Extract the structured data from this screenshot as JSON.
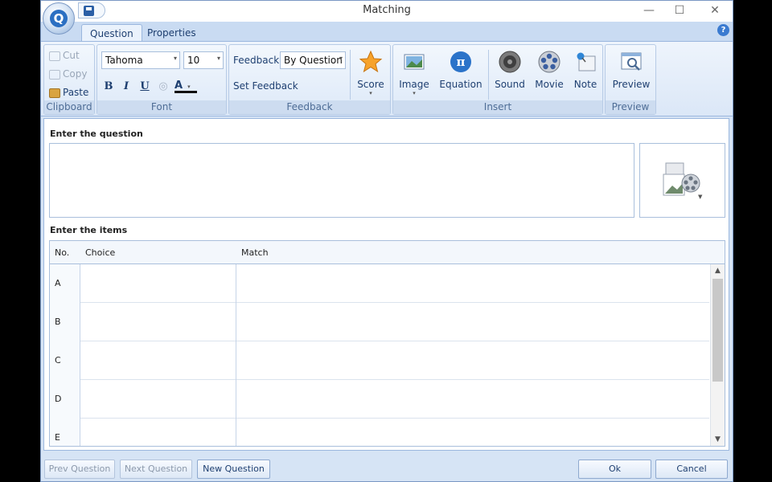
{
  "window": {
    "title": "Matching",
    "minimize": "—",
    "maximize": "☐",
    "close": "✕"
  },
  "tabs": [
    {
      "label": "Question"
    },
    {
      "label": "Properties"
    }
  ],
  "clipboard": {
    "cut": "Cut",
    "copy": "Copy",
    "paste": "Paste",
    "label": "Clipboard"
  },
  "font": {
    "name": "Tahoma",
    "size": "10",
    "bold": "B",
    "italic": "I",
    "underline": "U",
    "color_letter": "A",
    "label": "Font"
  },
  "feedback": {
    "feedback_label": "Feedback:",
    "feedback_value": "By Question",
    "set_feedback": "Set Feedback",
    "score": "Score",
    "label": "Feedback"
  },
  "insert": {
    "image": "Image",
    "equation": "Equation",
    "equation_symbol": "π",
    "sound": "Sound",
    "movie": "Movie",
    "note": "Note",
    "label": "Insert"
  },
  "preview": {
    "preview": "Preview",
    "label": "Preview"
  },
  "question": {
    "section_label": "Enter the question",
    "text": ""
  },
  "items": {
    "section_label": "Enter the items",
    "headers": {
      "no": "No.",
      "choice": "Choice",
      "match": "Match"
    },
    "rows": [
      {
        "no": "A",
        "choice": "",
        "match": ""
      },
      {
        "no": "B",
        "choice": "",
        "match": ""
      },
      {
        "no": "C",
        "choice": "",
        "match": ""
      },
      {
        "no": "D",
        "choice": "",
        "match": ""
      },
      {
        "no": "E",
        "choice": "",
        "match": ""
      }
    ]
  },
  "footer": {
    "prev": "Prev Question",
    "next": "Next Question",
    "new": "New Question",
    "ok": "Ok",
    "cancel": "Cancel"
  },
  "colors": {
    "accent": "#2b6fc2",
    "ribbon_bg": "#dbe7f7",
    "text_blue": "#1e3f70"
  }
}
